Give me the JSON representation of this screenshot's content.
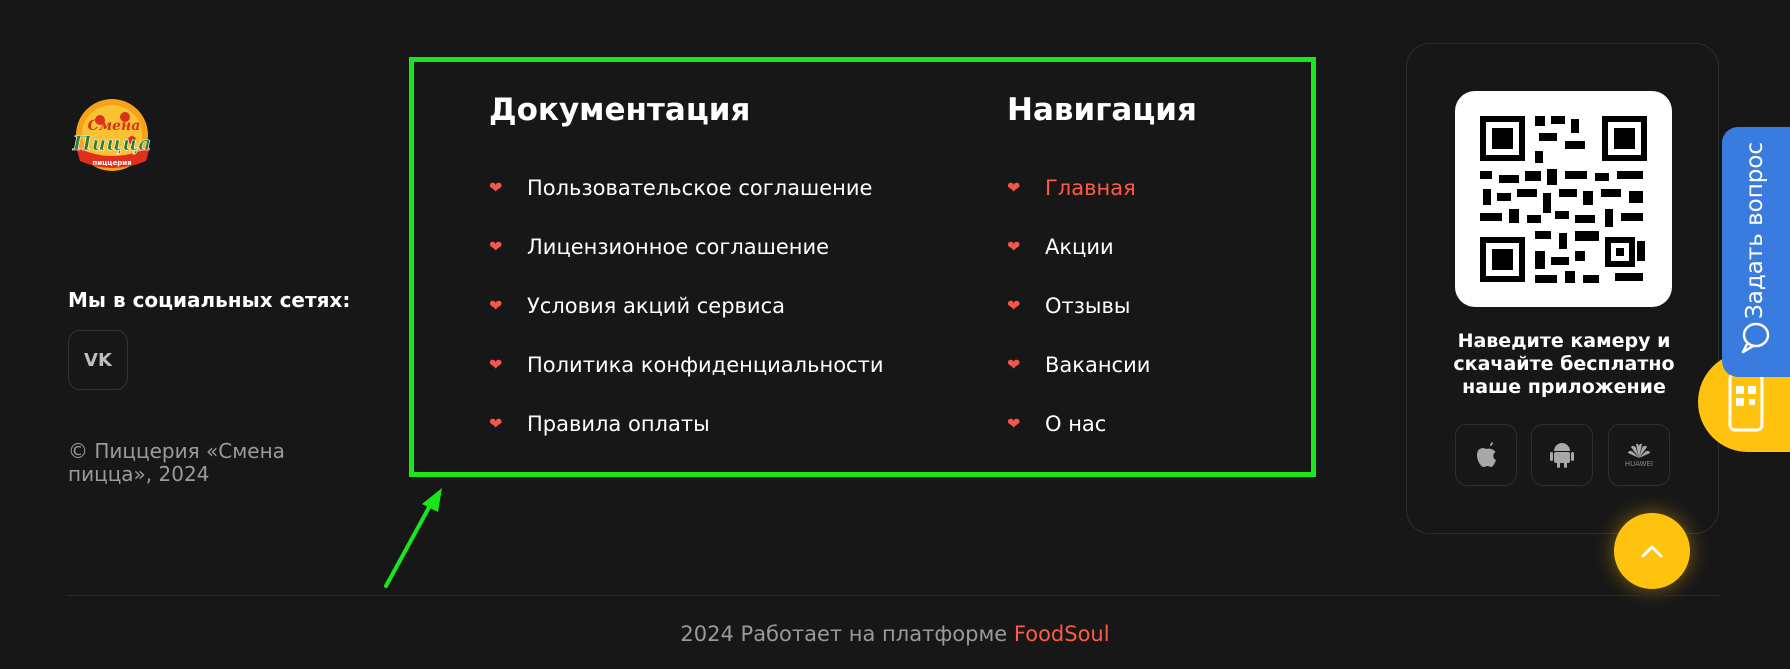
{
  "logo": {
    "brand_text_top": "Смена",
    "brand_text_main": "Пицца",
    "brand_text_sub": "пиццерия"
  },
  "social": {
    "title": "Мы в социальных сетях:",
    "vk_label": "VK"
  },
  "copyright": "© Пиццерия «Смена пицца», 2024",
  "documentation": {
    "title": "Документация",
    "items": [
      {
        "label": "Пользовательское соглашение"
      },
      {
        "label": "Лицензионное соглашение"
      },
      {
        "label": "Условия акций сервиса"
      },
      {
        "label": "Политика конфиденциальности"
      },
      {
        "label": "Правила оплаты"
      }
    ]
  },
  "navigation": {
    "title": "Навигация",
    "items": [
      {
        "label": "Главная",
        "active": true
      },
      {
        "label": "Акции"
      },
      {
        "label": "Отзывы"
      },
      {
        "label": "Вакансии"
      },
      {
        "label": "О нас"
      }
    ]
  },
  "app": {
    "prompt": "Наведите камеру и скачайте бесплатно наше приложение",
    "stores": [
      {
        "name": "apple-icon"
      },
      {
        "name": "android-icon"
      },
      {
        "name": "huawei-icon",
        "label": "HUAWEI"
      }
    ]
  },
  "ask_question": {
    "label": "Задать вопрос"
  },
  "footer": {
    "prefix": "2024 Работает на платформе ",
    "brand": "FoodSoul"
  },
  "colors": {
    "accent": "#ff5a44",
    "background": "#171717",
    "highlight": "#19e61b",
    "yellow": "#ffc20e",
    "blue": "#3a7be0"
  }
}
